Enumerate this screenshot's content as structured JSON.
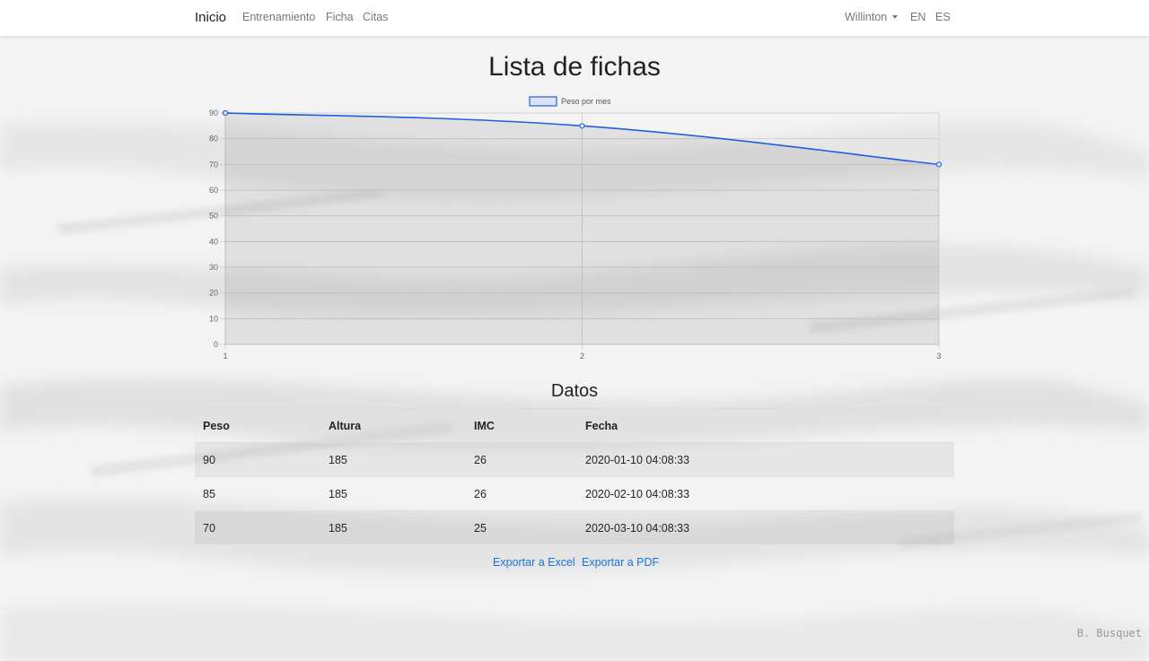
{
  "navbar": {
    "brand": "Inicio",
    "links": [
      "Entrenamiento",
      "Ficha",
      "Citas"
    ],
    "user": "Willinton",
    "languages": [
      "EN",
      "ES"
    ]
  },
  "page": {
    "title": "Lista de fichas",
    "subtitle": "Datos"
  },
  "chart_data": {
    "type": "line",
    "legend": "Peso por mes",
    "legend_position": "top-center",
    "x": [
      "1",
      "2",
      "3"
    ],
    "y_ticks": [
      "0",
      "10",
      "20",
      "30",
      "40",
      "50",
      "60",
      "70",
      "80",
      "90"
    ],
    "series": [
      {
        "name": "Peso por mes",
        "values": [
          90,
          85,
          70
        ]
      }
    ],
    "ylim": [
      0,
      90
    ],
    "fill": true,
    "grid": true,
    "line_color": "#1f5fe0"
  },
  "table": {
    "headers": [
      "Peso",
      "Altura",
      "IMC",
      "Fecha"
    ],
    "rows": [
      [
        "90",
        "185",
        "26",
        "2020-01-10 04:08:33"
      ],
      [
        "85",
        "185",
        "26",
        "2020-02-10 04:08:33"
      ],
      [
        "70",
        "185",
        "25",
        "2020-03-10 04:08:33"
      ]
    ]
  },
  "exports": {
    "excel": "Exportar a Excel",
    "pdf": "Exportar a PDF"
  },
  "watermark": "B. Busquet"
}
